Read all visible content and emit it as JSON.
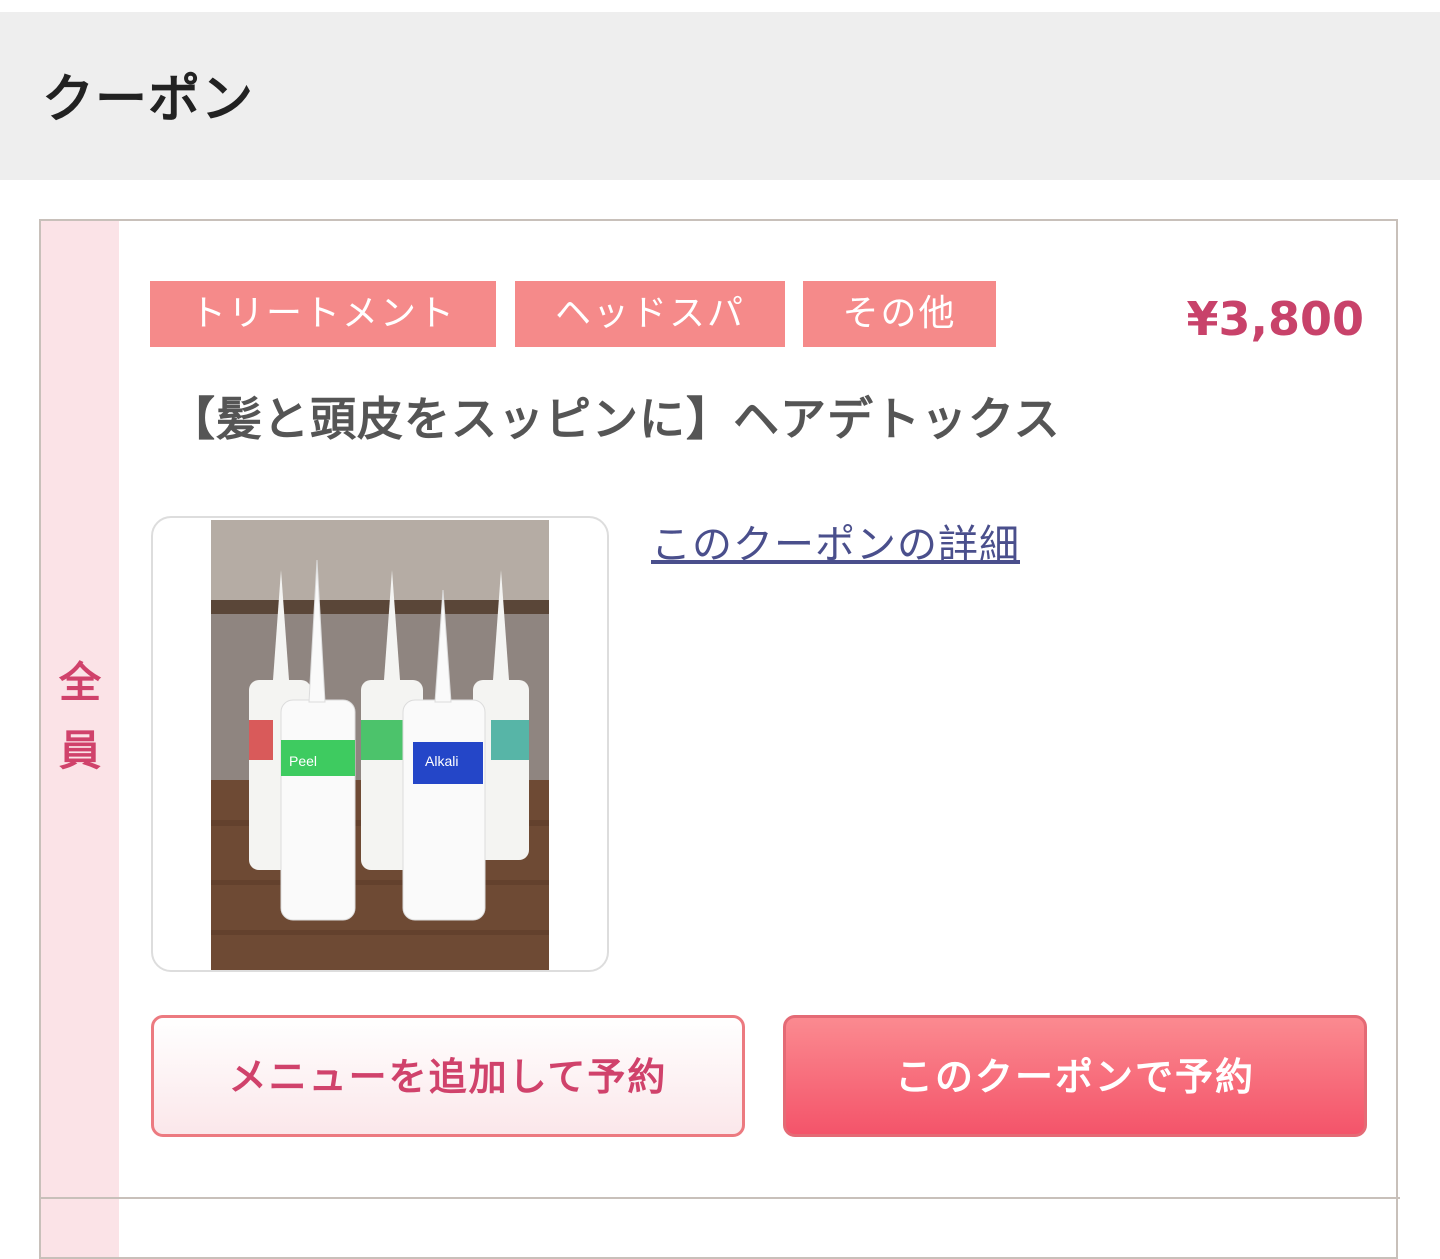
{
  "header": {
    "title": "クーポン"
  },
  "coupon": {
    "target_label": "全員",
    "tags": [
      "トリートメント",
      "ヘッドスパ",
      "その他"
    ],
    "price": "¥3,800",
    "title": "【髪と頭皮をスッピンに】ヘアデトックス",
    "detail_link": "このクーポンの詳細",
    "image": {
      "bottle_labels": [
        "Peel",
        "Alkali"
      ]
    },
    "buttons": {
      "add_menu": "メニューを追加して予約",
      "book": "このクーポンで予約"
    }
  },
  "colors": {
    "tag_bg": "#f58a8a",
    "price": "#c8426a",
    "side_bg": "#fbe3e7",
    "accent": "#d0426b"
  }
}
